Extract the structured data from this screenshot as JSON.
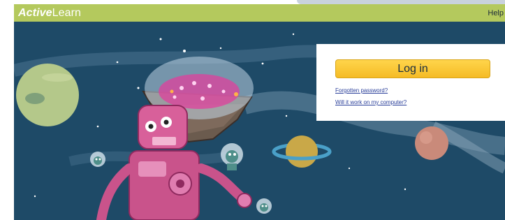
{
  "header": {
    "logo_part1": "Active",
    "logo_part2": "Learn",
    "help_label": "Help"
  },
  "login": {
    "button_label": "Log in",
    "forgotten_password": "Forgotten password?",
    "will_it_work": "Will it work on my computer?"
  },
  "colors": {
    "header_bg": "#b4c95d",
    "scene_bg": "#1e4a67",
    "button_yellow": "#f7c531",
    "link_blue": "#2a3f9a"
  }
}
